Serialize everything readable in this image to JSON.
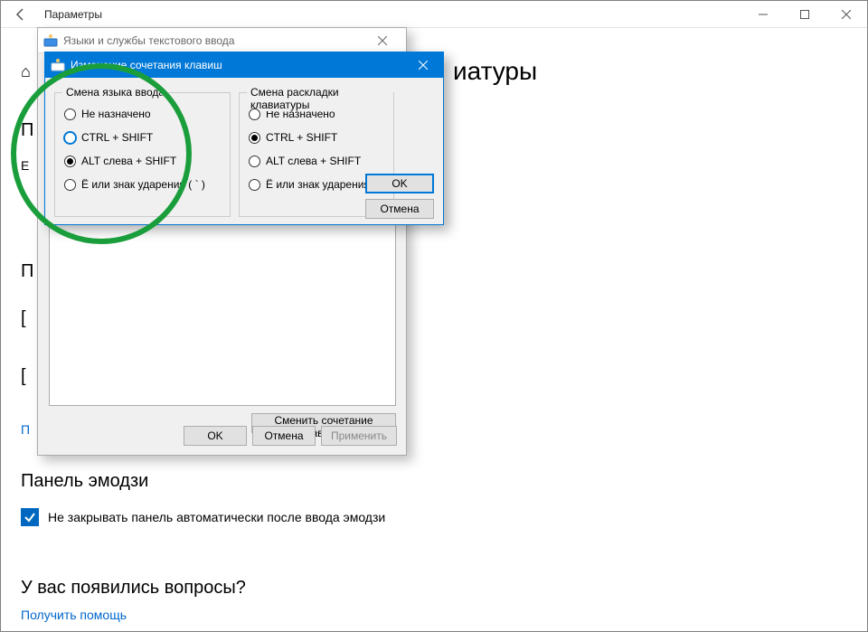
{
  "settings": {
    "title": "Параметры",
    "page_heading_partial": "иатуры",
    "left_fragments": {
      "home": "⌂",
      "p1": "П",
      "e": "Е",
      "p2": "П",
      "bracket1": "[",
      "bracket2": "[",
      "blue_p": "П"
    }
  },
  "text_services": {
    "title": "Языки и службы текстового ввода",
    "change_btn": "Сменить сочетание клавиш...",
    "ok": "OK",
    "cancel": "Отмена",
    "apply": "Применить"
  },
  "hotkey": {
    "title": "Изменение сочетания клавиш",
    "group_left": "Смена языка ввода",
    "group_right": "Смена раскладки клавиатуры",
    "options": {
      "none": "Не назначено",
      "ctrl_shift": "CTRL + SHIFT",
      "alt_shift": "ALT слева + SHIFT",
      "grave": "Ё или знак ударения ( ` )"
    },
    "ok": "OK",
    "cancel": "Отмена"
  },
  "emoji": {
    "heading": "Панель эмодзи",
    "checkbox": "Не закрывать панель автоматически после ввода эмодзи"
  },
  "questions": {
    "heading": "У вас появились вопросы?",
    "link": "Получить помощь"
  }
}
